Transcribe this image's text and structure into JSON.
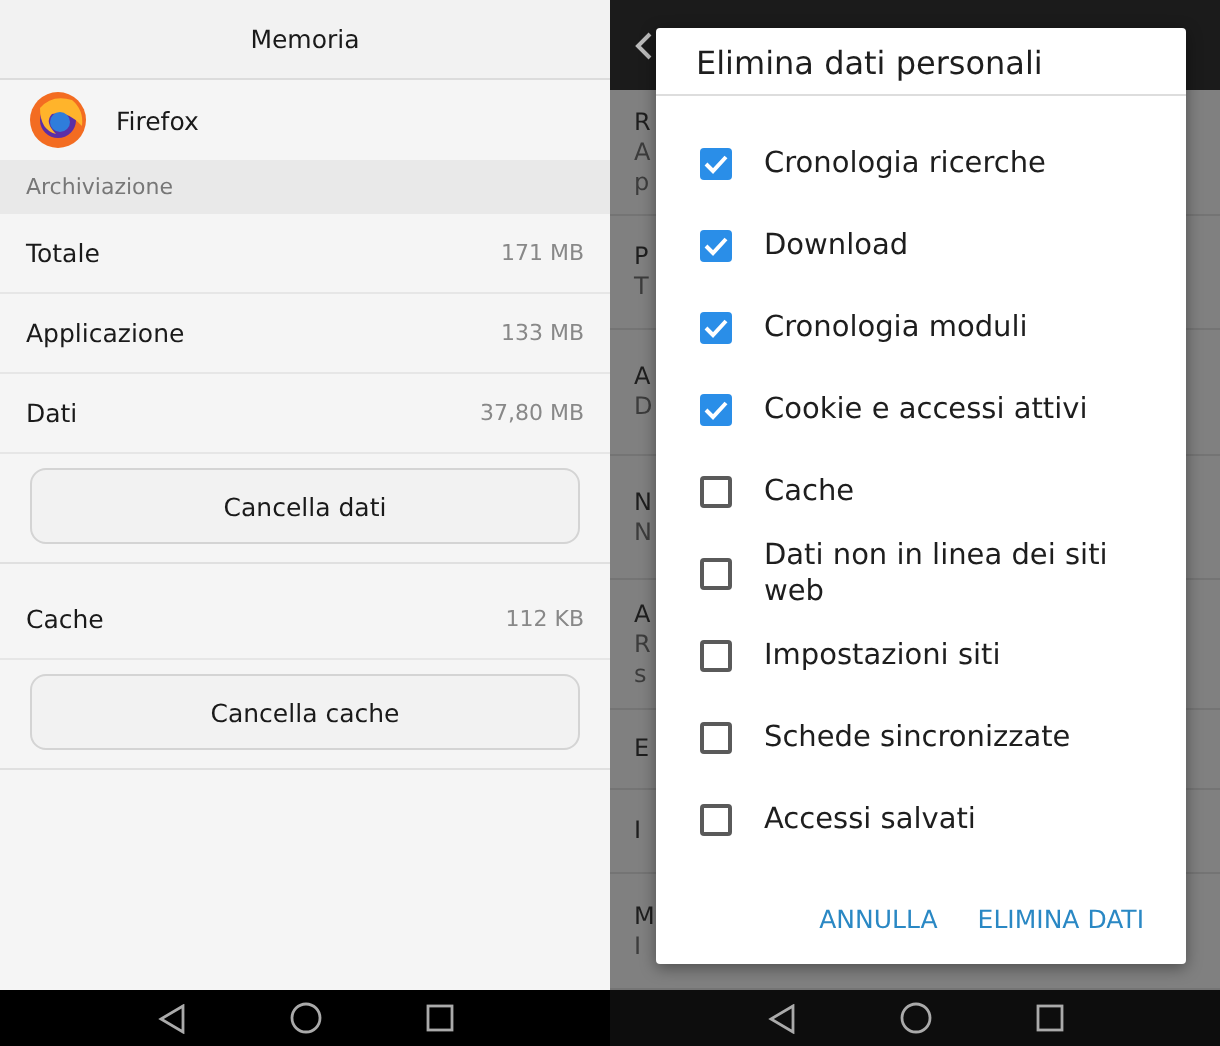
{
  "storage": {
    "title": "Memoria",
    "app": {
      "name": "Firefox"
    },
    "section": "Archiviazione",
    "rows": [
      {
        "label": "Totale",
        "value": "171 MB"
      },
      {
        "label": "Applicazione",
        "value": "133 MB"
      },
      {
        "label": "Dati",
        "value": "37,80 MB"
      }
    ],
    "clear_data_button": "Cancella dati",
    "cache": {
      "label": "Cache",
      "value": "112 KB"
    },
    "clear_cache_button": "Cancella cache"
  },
  "background_settings": {
    "rows": [
      {
        "lines": [
          "R",
          "A",
          "p"
        ]
      },
      {
        "lines": [
          "P",
          "T"
        ]
      },
      {
        "lines": [
          "A",
          "D"
        ]
      },
      {
        "lines": [
          "N",
          "N"
        ]
      },
      {
        "lines": [
          "A",
          "R",
          "s"
        ]
      },
      {
        "lines": [
          "E"
        ]
      },
      {
        "lines": [
          "I"
        ]
      },
      {
        "lines": [
          "M",
          "I"
        ]
      }
    ]
  },
  "dialog": {
    "title": "Elimina dati personali",
    "options": [
      {
        "label": "Cronologia ricerche",
        "checked": true
      },
      {
        "label": "Download",
        "checked": true
      },
      {
        "label": "Cronologia moduli",
        "checked": true
      },
      {
        "label": "Cookie e accessi attivi",
        "checked": true
      },
      {
        "label": "Cache",
        "checked": false
      },
      {
        "label": "Dati non in linea dei siti web",
        "checked": false
      },
      {
        "label": "Impostazioni siti",
        "checked": false
      },
      {
        "label": "Schede sincronizzate",
        "checked": false
      },
      {
        "label": "Accessi salvati",
        "checked": false
      }
    ],
    "buttons": [
      "ANNULLA",
      "ELIMINA DATI"
    ]
  }
}
